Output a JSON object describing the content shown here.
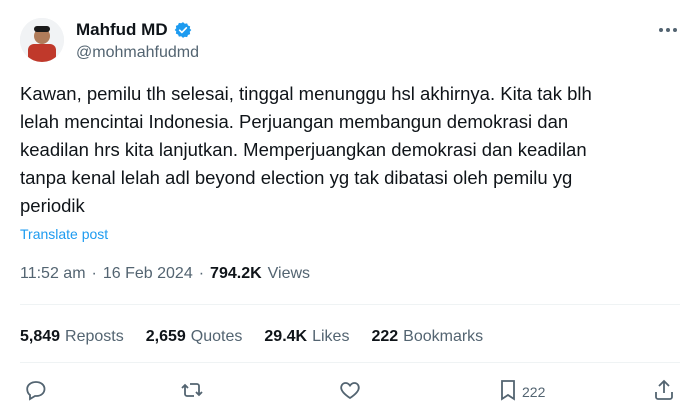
{
  "author": {
    "name": "Mahfud MD",
    "handle": "@mohmahfudmd",
    "verified": true
  },
  "tweet": {
    "text": "Kawan, pemilu tlh selesai, tinggal menunggu hsl akhirnya. Kita tak blh\nlelah mencintai Indonesia. Perjuangan membangun demokrasi dan\nkeadilan hrs kita lanjutkan. Memperjuangkan demokrasi dan keadilan\ntanpa kenal lelah adl beyond election yg tak dibatasi oleh pemilu yg\nperiodik",
    "translate_label": "Translate post"
  },
  "meta": {
    "time": "11:52 am",
    "sep1": "·",
    "date": "16 Feb 2024",
    "sep2": "·",
    "views_count": "794.2K",
    "views_label": "Views"
  },
  "stats": [
    {
      "count": "5,849",
      "label": "Reposts"
    },
    {
      "count": "2,659",
      "label": "Quotes"
    },
    {
      "count": "29.4K",
      "label": "Likes"
    },
    {
      "count": "222",
      "label": "Bookmarks"
    }
  ],
  "actions": {
    "bookmark_count": "222"
  },
  "colors": {
    "accent": "#1d9bf0",
    "text_secondary": "#536471",
    "divider": "#eff3f4"
  }
}
